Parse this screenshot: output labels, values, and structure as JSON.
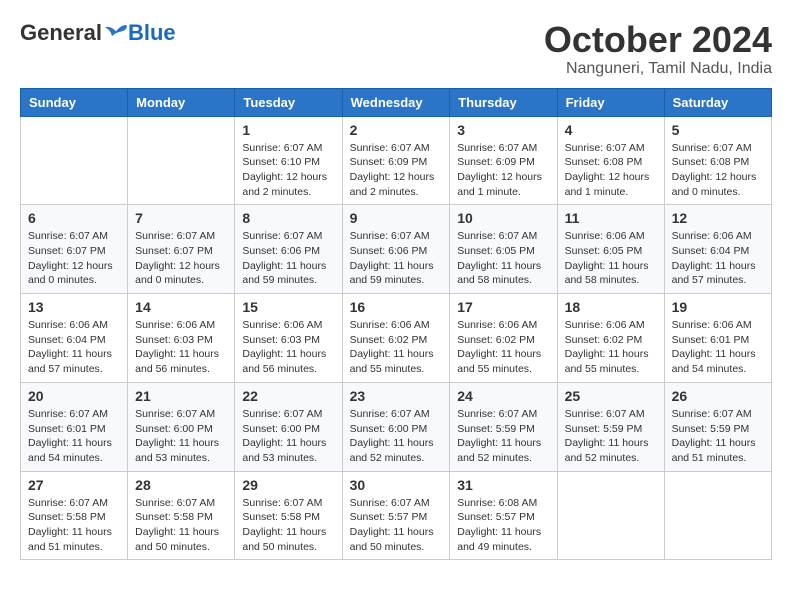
{
  "header": {
    "logo": {
      "general": "General",
      "blue": "Blue"
    },
    "title": "October 2024",
    "location": "Nanguneri, Tamil Nadu, India"
  },
  "weekdays": [
    "Sunday",
    "Monday",
    "Tuesday",
    "Wednesday",
    "Thursday",
    "Friday",
    "Saturday"
  ],
  "weeks": [
    [
      {
        "day": "",
        "content": ""
      },
      {
        "day": "",
        "content": ""
      },
      {
        "day": "1",
        "content": "Sunrise: 6:07 AM\nSunset: 6:10 PM\nDaylight: 12 hours and 2 minutes."
      },
      {
        "day": "2",
        "content": "Sunrise: 6:07 AM\nSunset: 6:09 PM\nDaylight: 12 hours and 2 minutes."
      },
      {
        "day": "3",
        "content": "Sunrise: 6:07 AM\nSunset: 6:09 PM\nDaylight: 12 hours and 1 minute."
      },
      {
        "day": "4",
        "content": "Sunrise: 6:07 AM\nSunset: 6:08 PM\nDaylight: 12 hours and 1 minute."
      },
      {
        "day": "5",
        "content": "Sunrise: 6:07 AM\nSunset: 6:08 PM\nDaylight: 12 hours and 0 minutes."
      }
    ],
    [
      {
        "day": "6",
        "content": "Sunrise: 6:07 AM\nSunset: 6:07 PM\nDaylight: 12 hours and 0 minutes."
      },
      {
        "day": "7",
        "content": "Sunrise: 6:07 AM\nSunset: 6:07 PM\nDaylight: 12 hours and 0 minutes."
      },
      {
        "day": "8",
        "content": "Sunrise: 6:07 AM\nSunset: 6:06 PM\nDaylight: 11 hours and 59 minutes."
      },
      {
        "day": "9",
        "content": "Sunrise: 6:07 AM\nSunset: 6:06 PM\nDaylight: 11 hours and 59 minutes."
      },
      {
        "day": "10",
        "content": "Sunrise: 6:07 AM\nSunset: 6:05 PM\nDaylight: 11 hours and 58 minutes."
      },
      {
        "day": "11",
        "content": "Sunrise: 6:06 AM\nSunset: 6:05 PM\nDaylight: 11 hours and 58 minutes."
      },
      {
        "day": "12",
        "content": "Sunrise: 6:06 AM\nSunset: 6:04 PM\nDaylight: 11 hours and 57 minutes."
      }
    ],
    [
      {
        "day": "13",
        "content": "Sunrise: 6:06 AM\nSunset: 6:04 PM\nDaylight: 11 hours and 57 minutes."
      },
      {
        "day": "14",
        "content": "Sunrise: 6:06 AM\nSunset: 6:03 PM\nDaylight: 11 hours and 56 minutes."
      },
      {
        "day": "15",
        "content": "Sunrise: 6:06 AM\nSunset: 6:03 PM\nDaylight: 11 hours and 56 minutes."
      },
      {
        "day": "16",
        "content": "Sunrise: 6:06 AM\nSunset: 6:02 PM\nDaylight: 11 hours and 55 minutes."
      },
      {
        "day": "17",
        "content": "Sunrise: 6:06 AM\nSunset: 6:02 PM\nDaylight: 11 hours and 55 minutes."
      },
      {
        "day": "18",
        "content": "Sunrise: 6:06 AM\nSunset: 6:02 PM\nDaylight: 11 hours and 55 minutes."
      },
      {
        "day": "19",
        "content": "Sunrise: 6:06 AM\nSunset: 6:01 PM\nDaylight: 11 hours and 54 minutes."
      }
    ],
    [
      {
        "day": "20",
        "content": "Sunrise: 6:07 AM\nSunset: 6:01 PM\nDaylight: 11 hours and 54 minutes."
      },
      {
        "day": "21",
        "content": "Sunrise: 6:07 AM\nSunset: 6:00 PM\nDaylight: 11 hours and 53 minutes."
      },
      {
        "day": "22",
        "content": "Sunrise: 6:07 AM\nSunset: 6:00 PM\nDaylight: 11 hours and 53 minutes."
      },
      {
        "day": "23",
        "content": "Sunrise: 6:07 AM\nSunset: 6:00 PM\nDaylight: 11 hours and 52 minutes."
      },
      {
        "day": "24",
        "content": "Sunrise: 6:07 AM\nSunset: 5:59 PM\nDaylight: 11 hours and 52 minutes."
      },
      {
        "day": "25",
        "content": "Sunrise: 6:07 AM\nSunset: 5:59 PM\nDaylight: 11 hours and 52 minutes."
      },
      {
        "day": "26",
        "content": "Sunrise: 6:07 AM\nSunset: 5:59 PM\nDaylight: 11 hours and 51 minutes."
      }
    ],
    [
      {
        "day": "27",
        "content": "Sunrise: 6:07 AM\nSunset: 5:58 PM\nDaylight: 11 hours and 51 minutes."
      },
      {
        "day": "28",
        "content": "Sunrise: 6:07 AM\nSunset: 5:58 PM\nDaylight: 11 hours and 50 minutes."
      },
      {
        "day": "29",
        "content": "Sunrise: 6:07 AM\nSunset: 5:58 PM\nDaylight: 11 hours and 50 minutes."
      },
      {
        "day": "30",
        "content": "Sunrise: 6:07 AM\nSunset: 5:57 PM\nDaylight: 11 hours and 50 minutes."
      },
      {
        "day": "31",
        "content": "Sunrise: 6:08 AM\nSunset: 5:57 PM\nDaylight: 11 hours and 49 minutes."
      },
      {
        "day": "",
        "content": ""
      },
      {
        "day": "",
        "content": ""
      }
    ]
  ]
}
